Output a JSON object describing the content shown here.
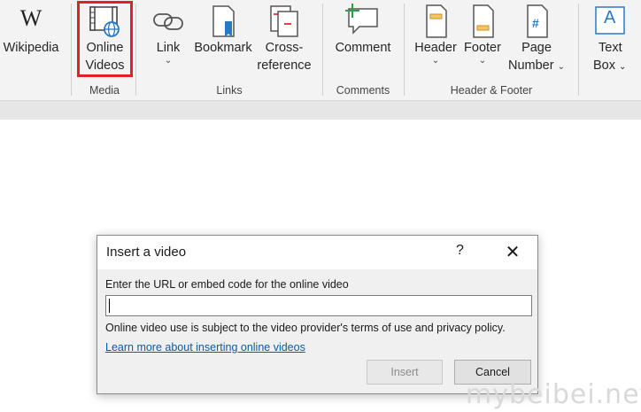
{
  "ribbon": {
    "buttons": {
      "wikipedia": {
        "label": "Wikipedia",
        "icon": "wikipedia-icon",
        "glyph": "W"
      },
      "online_videos": {
        "line1": "Online",
        "line2": "Videos",
        "icon": "film-globe-icon"
      },
      "link": {
        "label": "Link",
        "icon": "link-icon"
      },
      "bookmark": {
        "label": "Bookmark",
        "icon": "bookmark-icon"
      },
      "cross_reference": {
        "line1": "Cross-",
        "line2": "reference",
        "icon": "cross-reference-icon"
      },
      "comment": {
        "label": "Comment",
        "icon": "comment-icon"
      },
      "header": {
        "label": "Header",
        "icon": "header-icon"
      },
      "footer": {
        "label": "Footer",
        "icon": "footer-icon"
      },
      "page_number": {
        "line1": "Page",
        "line2": "Number",
        "icon": "page-number-icon",
        "glyph": "#"
      },
      "text_box": {
        "line1": "Text",
        "line2": "Box",
        "icon": "text-box-icon",
        "glyph": "A"
      }
    },
    "groups": {
      "media": "Media",
      "links": "Links",
      "comments": "Comments",
      "header_footer": "Header & Footer"
    },
    "dropdown_glyph": "⌄",
    "highlight_color": "#e0202a"
  },
  "dialog": {
    "title": "Insert a video",
    "help": "?",
    "close": "✕",
    "prompt": "Enter the URL or embed code for the online video",
    "url_value": "",
    "note": "Online video use is subject to the video provider's terms of use and privacy policy.",
    "learn_more": "Learn more about inserting online videos",
    "insert_label": "Insert",
    "cancel_label": "Cancel"
  },
  "watermark": "mybeibei.net"
}
